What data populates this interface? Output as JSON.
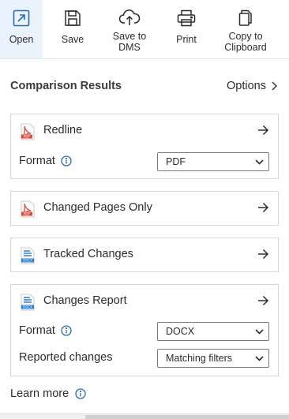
{
  "toolbar": {
    "open": "Open",
    "save": "Save",
    "save_dms": [
      "Save to",
      "DMS"
    ],
    "print": "Print",
    "copy": [
      "Copy to",
      "Clipboard"
    ]
  },
  "results": {
    "title": "Comparison Results",
    "options": "Options"
  },
  "redline": {
    "title": "Redline",
    "format_label": "Format",
    "format_value": "PDF",
    "icon": "pdf-file-icon"
  },
  "changed_pages": {
    "title": "Changed Pages Only",
    "icon": "pdf-file-icon"
  },
  "tracked_changes": {
    "title": "Tracked Changes",
    "icon": "docx-file-icon"
  },
  "changes_report": {
    "title": "Changes Report",
    "format_label": "Format",
    "format_value": "DOCX",
    "reported_label": "Reported changes",
    "reported_value": "Matching filters",
    "icon": "docx-file-icon"
  },
  "learn_more": "Learn more",
  "colors": {
    "accent": "#2b6cb0",
    "active_bg": "#eaf2fb",
    "pdf_red": "#e04a3f",
    "docx_blue": "#2f7dd1"
  }
}
